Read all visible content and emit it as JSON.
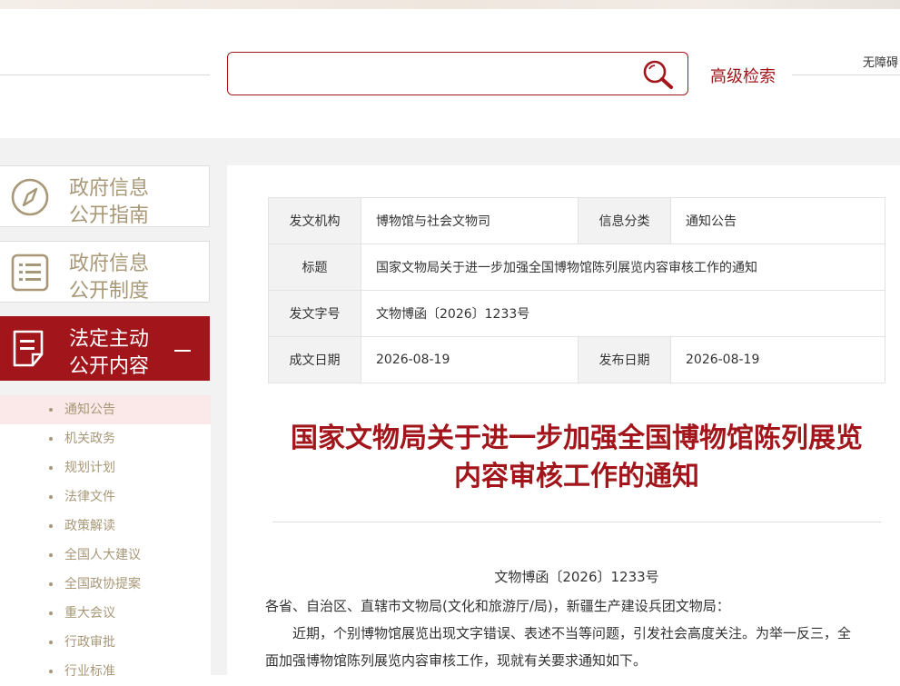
{
  "header": {
    "search_placeholder": "",
    "advanced_search": "高级检索",
    "accessibility": "无障碍"
  },
  "sidebar": {
    "cards": [
      {
        "line1": "政府信息",
        "line2": "公开指南",
        "icon": "compass-icon",
        "active": false
      },
      {
        "line1": "政府信息",
        "line2": "公开制度",
        "icon": "list-document-icon",
        "active": false
      },
      {
        "line1": "法定主动",
        "line2": "公开内容",
        "icon": "note-document-icon",
        "active": true
      }
    ],
    "sub_items": [
      {
        "label": "通知公告",
        "active": true
      },
      {
        "label": "机关政务"
      },
      {
        "label": "规划计划"
      },
      {
        "label": "法律文件"
      },
      {
        "label": "政策解读"
      },
      {
        "label": "全国人大建议"
      },
      {
        "label": "全国政协提案"
      },
      {
        "label": "重大会议"
      },
      {
        "label": "行政审批"
      },
      {
        "label": "行业标准"
      }
    ]
  },
  "info_table": {
    "issuer_label": "发文机构",
    "issuer": "博物馆与社会文物司",
    "category_label": "信息分类",
    "category": "通知公告",
    "title_label": "标题",
    "title": "国家文物局关于进一步加强全国博物馆陈列展览内容审核工作的通知",
    "doc_no_label": "发文字号",
    "doc_no": "文物博函〔2026〕1233号",
    "created_label": "成文日期",
    "created": "2026-08-19",
    "published_label": "发布日期",
    "published": "2026-08-19"
  },
  "article": {
    "title_line1": "国家文物局关于进一步加强全国博物馆陈列展览",
    "title_line2": "内容审核工作的通知",
    "doc_no": "文物博函〔2026〕1233号",
    "salutation": "各省、自治区、直辖市文物局(文化和旅游厅/局)，新疆生产建设兵团文物局：",
    "para1_line1": "近期，个别博物馆展览出现文字错误、表述不当等问题，引发社会高度关注。为举一反三，全",
    "para1_line2": "面加强博物馆陈列展览内容审核工作，现就有关要求通知如下。"
  },
  "colors": {
    "accent": "#a2161b",
    "sidebar_text": "#a89878",
    "background_gray": "#f2f2f2"
  }
}
